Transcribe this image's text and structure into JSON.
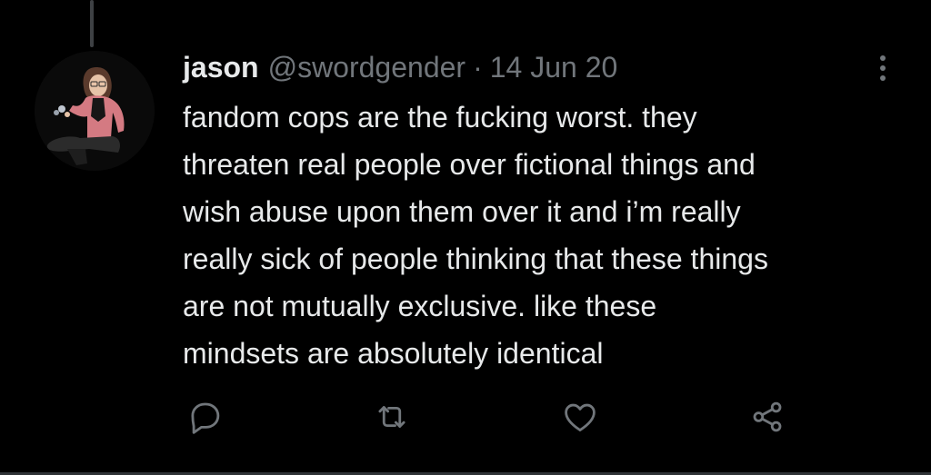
{
  "tweet": {
    "display_name": "jason",
    "handle": "@swordgender",
    "separator": "·",
    "date": "14 Jun 20",
    "text_lines": [
      "fandom cops are the fucking worst. they",
      "threaten real people over fictional things and",
      "wish abuse upon them over it and i’m really",
      "really sick of people thinking that these things",
      "are not mutually exclusive. like these",
      "mindsets are absolutely identical"
    ]
  },
  "icons": {
    "more": "more-vertical-icon",
    "reply": "reply-icon",
    "retweet": "retweet-icon",
    "like": "like-icon",
    "share": "share-icon"
  },
  "colors": {
    "background": "#000000",
    "text_primary": "#e7e9ea",
    "text_secondary": "#71767b",
    "border": "#2f3336"
  }
}
